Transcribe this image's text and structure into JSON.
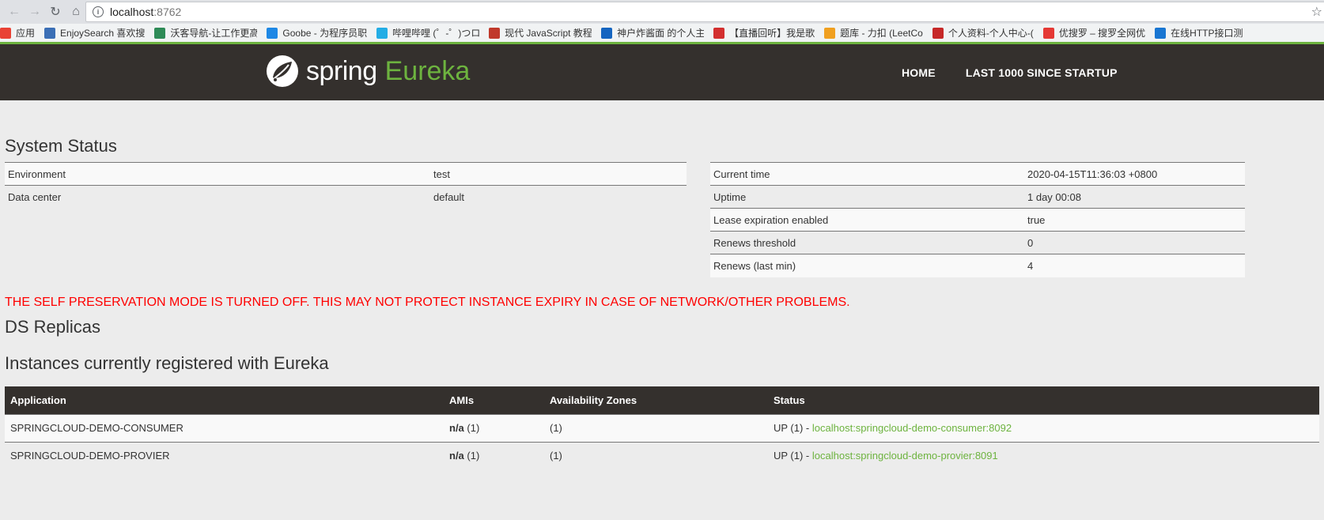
{
  "browser": {
    "url_host": "localhost",
    "url_port": ":8762",
    "bookmarks": [
      {
        "label": "应用",
        "icon": "apps-grid-icon",
        "color": "#e94235"
      },
      {
        "label": "EnjoySearch 喜欢搜",
        "icon": "enjoysearch-icon",
        "color": "#3b6fb6"
      },
      {
        "label": "沃客导航-让工作更高",
        "icon": "wokao-icon",
        "color": "#2e8b57"
      },
      {
        "label": "Goobe - 为程序员职",
        "icon": "goobe-icon",
        "color": "#1e88e5"
      },
      {
        "label": "哔哩哔哩 (゜-゜)つロ",
        "icon": "bilibili-icon",
        "color": "#23ade5"
      },
      {
        "label": "现代 JavaScript 教程",
        "icon": "javascript-info-icon",
        "color": "#c0392b"
      },
      {
        "label": "神户炸酱面 的个人主",
        "icon": "profile-globe-icon",
        "color": "#1565c0"
      },
      {
        "label": "【直播回听】我是歌",
        "icon": "ting-icon",
        "color": "#d32f2f"
      },
      {
        "label": "题库 - 力扣 (LeetCo",
        "icon": "leetcode-icon",
        "color": "#f0a020"
      },
      {
        "label": "个人资料-个人中心-(",
        "icon": "csdn-icon",
        "color": "#c62828"
      },
      {
        "label": "优搜罗 – 搜罗全网优",
        "icon": "yousouluo-icon",
        "color": "#e53935"
      },
      {
        "label": "在线HTTP接口测",
        "icon": "http-test-icon",
        "color": "#1976d2"
      }
    ]
  },
  "header": {
    "brand_spring": "spring",
    "brand_eureka": "Eureka",
    "nav": [
      "HOME",
      "LAST 1000 SINCE STARTUP"
    ]
  },
  "system_status": {
    "title": "System Status",
    "left": [
      {
        "label": "Environment",
        "value": "test"
      },
      {
        "label": "Data center",
        "value": "default"
      }
    ],
    "right": [
      {
        "label": "Current time",
        "value": "2020-04-15T11:36:03 +0800"
      },
      {
        "label": "Uptime",
        "value": "1 day 00:08"
      },
      {
        "label": "Lease expiration enabled",
        "value": "true"
      },
      {
        "label": "Renews threshold",
        "value": "0"
      },
      {
        "label": "Renews (last min)",
        "value": "4"
      }
    ]
  },
  "warning": "THE SELF PRESERVATION MODE IS TURNED OFF. THIS MAY NOT PROTECT INSTANCE EXPIRY IN CASE OF NETWORK/OTHER PROBLEMS.",
  "ds_replicas_title": "DS Replicas",
  "instances": {
    "title": "Instances currently registered with Eureka",
    "headers": [
      "Application",
      "AMIs",
      "Availability Zones",
      "Status"
    ],
    "rows": [
      {
        "app": "SPRINGCLOUD-DEMO-CONSUMER",
        "ami_bold": "n/a",
        "ami_count": " (1)",
        "zones": "(1)",
        "status_prefix": "UP (1) - ",
        "status_link": "localhost:springcloud-demo-consumer:8092"
      },
      {
        "app": "SPRINGCLOUD-DEMO-PROVIER",
        "ami_bold": "n/a",
        "ami_count": " (1)",
        "zones": "(1)",
        "status_prefix": "UP (1) - ",
        "status_link": "localhost:springcloud-demo-provier:8091"
      }
    ]
  }
}
